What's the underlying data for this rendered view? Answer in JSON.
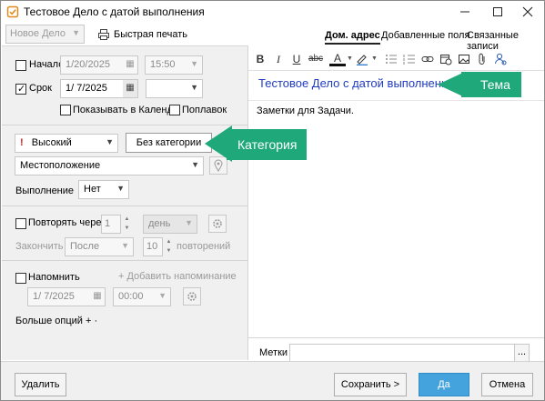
{
  "window": {
    "title": "Тестовое Дело с датой выполнения",
    "minimize": "—",
    "maximize": "☐",
    "close": "✕"
  },
  "toolbar": {
    "template_value": "Новое Дело",
    "quick_print": "Быстрая печать",
    "tabs": [
      "Дом. адрес",
      "Добавленные поля",
      "Связанные записи"
    ]
  },
  "left": {
    "start_label": "Начало",
    "start_date": "1/20/2025",
    "start_time": "15:50",
    "due_label": "Срок",
    "due_date": "1/  7/2025",
    "show_in_calendar": "Показывать в Календа|",
    "float": "Поплавок",
    "priority_mark": "!",
    "priority": "Высокий",
    "category": "Без категории",
    "location": "Местоположение",
    "completion_label": "Выполнение",
    "completion_value": "Нет",
    "repeat_label": "Повторять через",
    "repeat_count": "1",
    "repeat_unit": "день",
    "end_label": "Закончить",
    "end_value": "После",
    "repeat_times": "10",
    "repeats_word": "повторений",
    "remind_label": "Напомнить",
    "add_reminder": "+ Добавить напоминание",
    "remind_date": "1/  7/2025",
    "remind_time": "00:00",
    "more_options": "Больше опций + ·"
  },
  "right": {
    "subject": "Тестовое Дело с датой выполнения",
    "notes": "Заметки для Задачи.",
    "tags_label": "Метки",
    "tags_more": "..."
  },
  "callouts": {
    "subject": "Тема",
    "category": "Категория"
  },
  "buttons": {
    "delete": "Удалить",
    "save": "Сохранить >",
    "ok": "Да",
    "cancel": "Отмена"
  },
  "colors": {
    "callout": "#1fa97a",
    "subject_text": "#1f3ac2",
    "primary_button": "#44a3dd",
    "priority_mark": "#d62020"
  }
}
